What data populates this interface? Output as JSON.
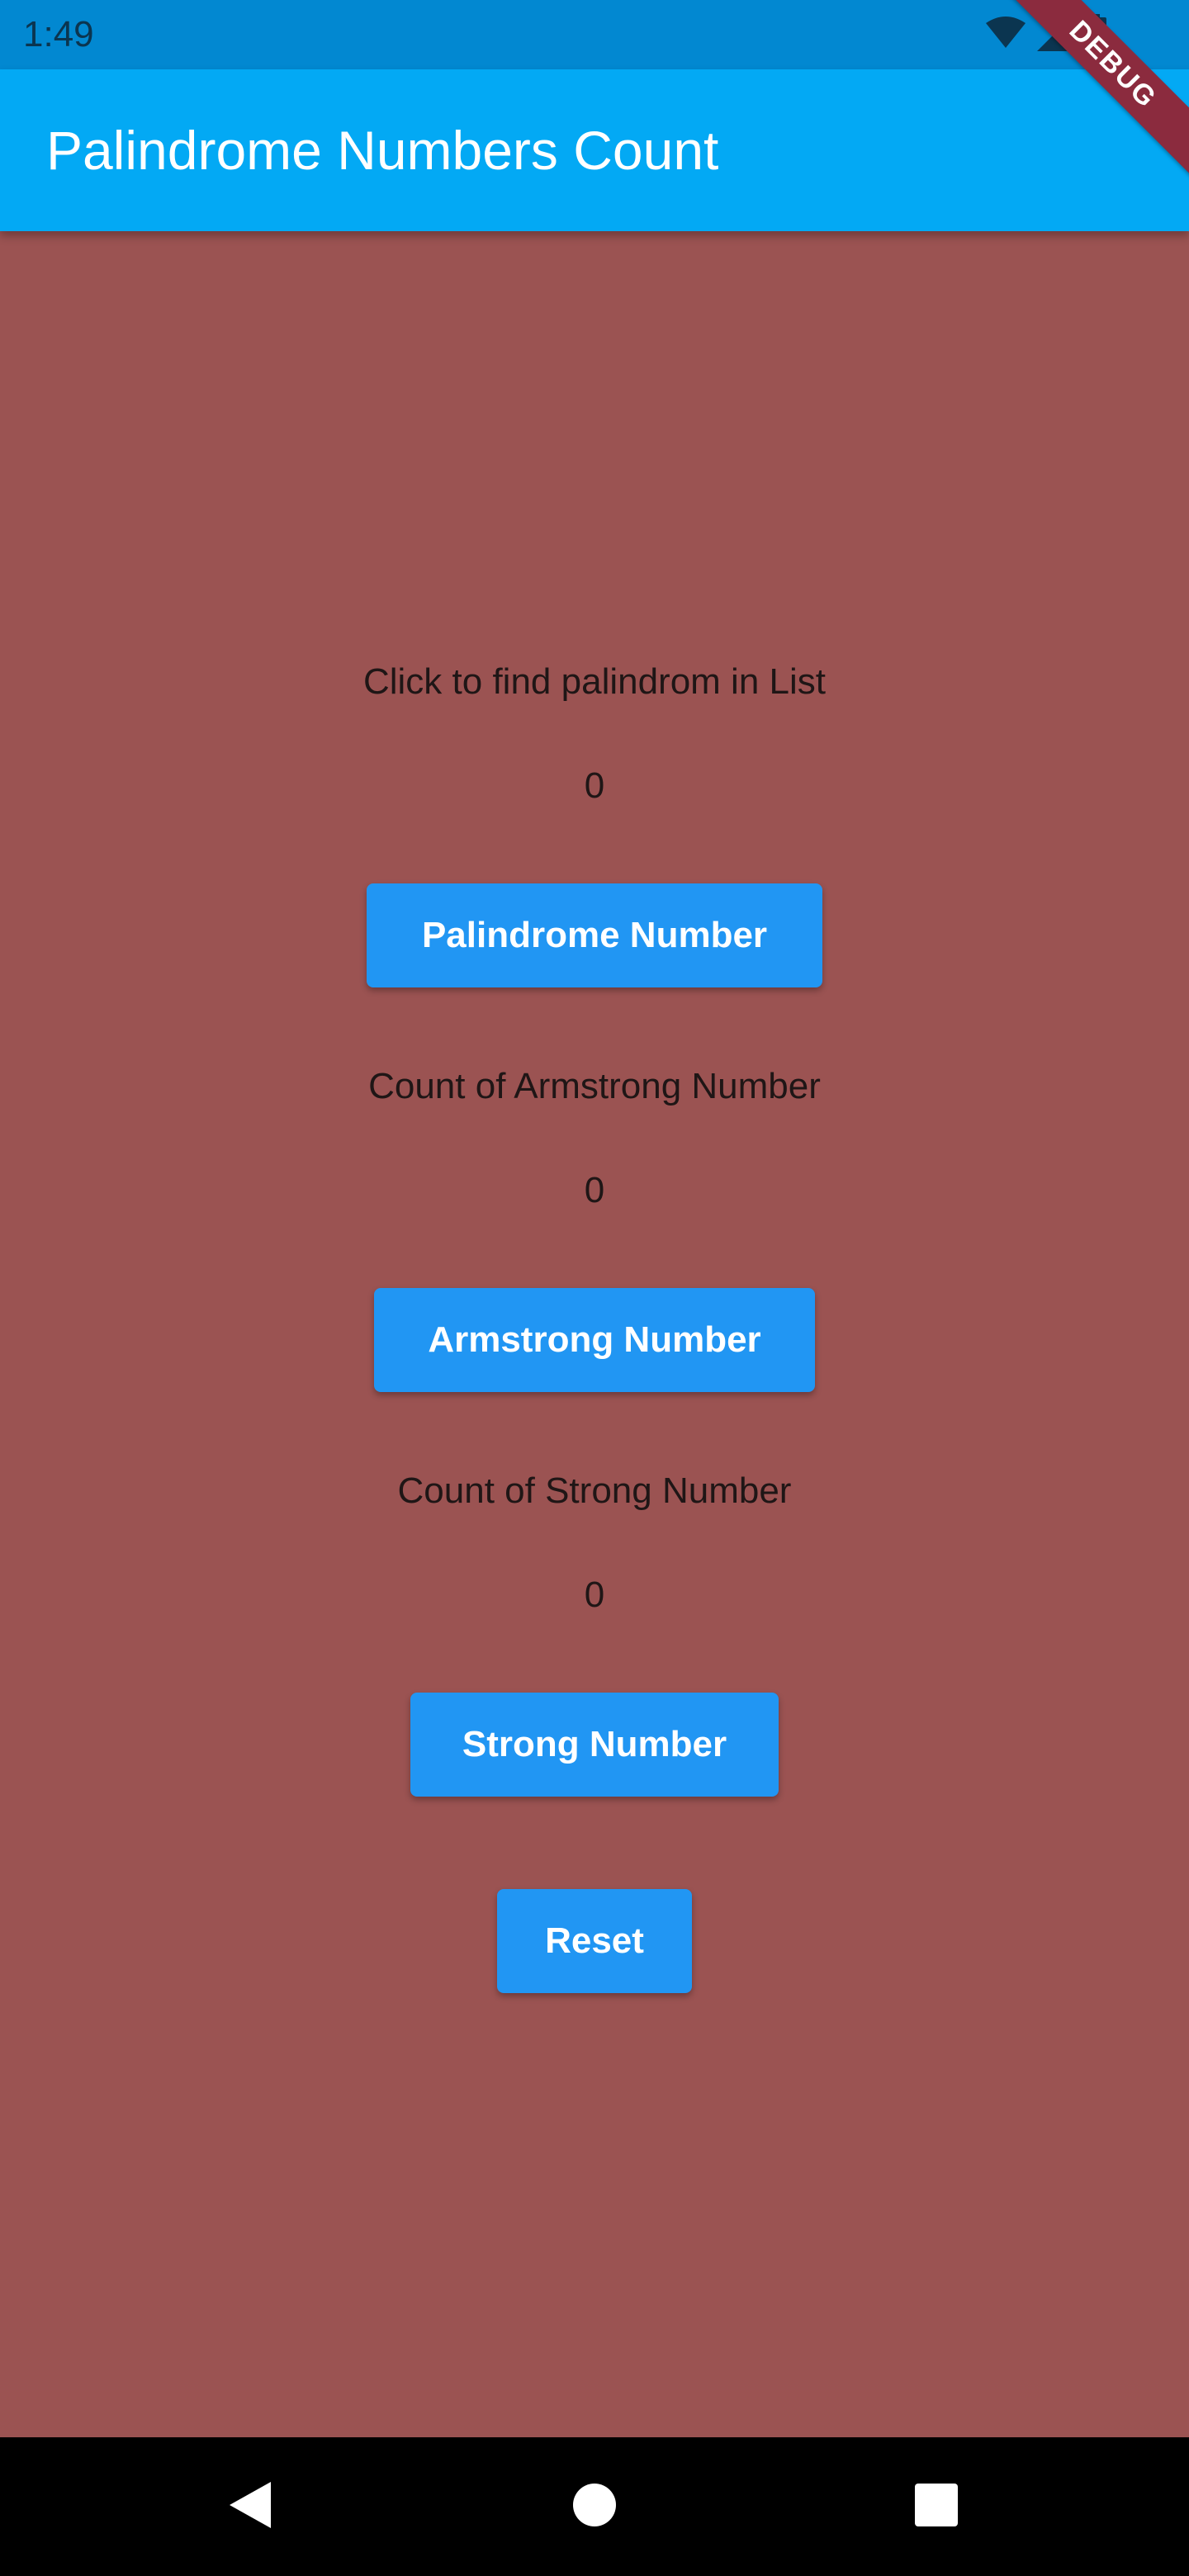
{
  "status_bar": {
    "time": "1:49",
    "icons": [
      "wifi-icon",
      "signal-icon",
      "battery-icon"
    ]
  },
  "app_bar": {
    "title": "Palindrome Numbers Count",
    "debug_label": "DEBUG"
  },
  "sections": {
    "palindrome": {
      "label": "Click to find palindrom in List",
      "count": "0",
      "button_label": "Palindrome Number"
    },
    "armstrong": {
      "label": "Count of Armstrong Number",
      "count": "0",
      "button_label": "Armstrong Number"
    },
    "strong": {
      "label": "Count of Strong Number",
      "count": "0",
      "button_label": "Strong Number"
    },
    "reset_label": "Reset"
  },
  "nav_bar": {
    "icons": [
      "back-icon",
      "home-icon",
      "recents-icon"
    ]
  },
  "colors": {
    "background": "#9b5352",
    "app_bar": "#03a9f4",
    "status_bar": "#0288d1",
    "button": "#2196f3",
    "debug_ribbon": "#8b2b3e"
  }
}
